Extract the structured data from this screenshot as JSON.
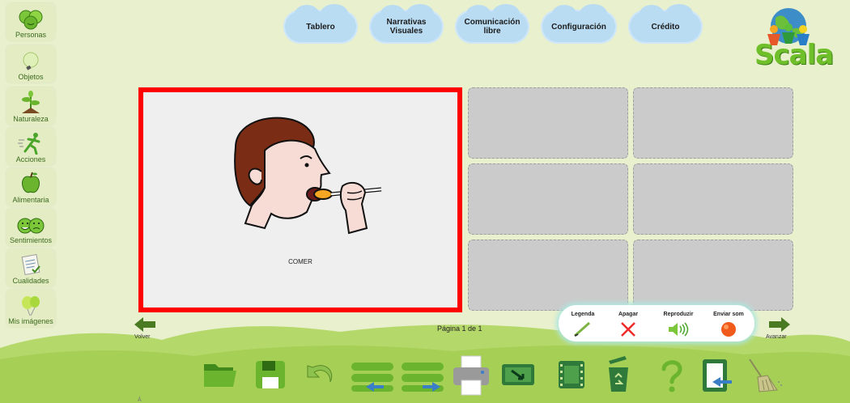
{
  "sidebar": {
    "items": [
      {
        "label": "Personas",
        "icon": "faces-icon"
      },
      {
        "label": "Objetos",
        "icon": "lightbulb-icon"
      },
      {
        "label": "Naturaleza",
        "icon": "sprout-icon"
      },
      {
        "label": "Acciones",
        "icon": "running-person-icon"
      },
      {
        "label": "Alimentaria",
        "icon": "apple-icon"
      },
      {
        "label": "Sentimientos",
        "icon": "emotion-faces-icon"
      },
      {
        "label": "Cualidades",
        "icon": "checklist-icon"
      },
      {
        "label": "Mis imágenes",
        "icon": "balloons-icon"
      }
    ]
  },
  "tabs": [
    {
      "label": "Tablero"
    },
    {
      "label": "Narrativas Visuales"
    },
    {
      "label": "Comunicación libre"
    },
    {
      "label": "Configuración"
    },
    {
      "label": "Crédito"
    }
  ],
  "logo": {
    "text": "Scala"
  },
  "board": {
    "main_caption": "COMER",
    "main_image_icon": "person-eating-icon",
    "selected_border_color": "#ff0000",
    "empty_cell_color": "#cbcbcb"
  },
  "nav": {
    "back_label": "Volver",
    "forward_label": "Avanzar",
    "page_indicator": "Página 1 de 1"
  },
  "legend_panel": {
    "items": [
      {
        "label": "Legenda",
        "icon": "pencil-icon"
      },
      {
        "label": "Apagar",
        "icon": "red-x-icon"
      },
      {
        "label": "Reproduzir",
        "icon": "speaker-icon"
      },
      {
        "label": "Enviar som",
        "icon": "record-dot-icon"
      }
    ]
  },
  "toolbar": {
    "tools": [
      {
        "name": "open-folder-icon"
      },
      {
        "name": "save-disk-icon"
      },
      {
        "name": "undo-icon"
      },
      {
        "name": "move-left-icon"
      },
      {
        "name": "move-right-icon"
      },
      {
        "name": "print-icon"
      },
      {
        "name": "screen-capture-icon"
      },
      {
        "name": "film-icon"
      },
      {
        "name": "trash-icon"
      },
      {
        "name": "help-icon"
      },
      {
        "name": "exit-icon"
      },
      {
        "name": "broom-icon"
      }
    ]
  },
  "colors": {
    "background": "#e9f0cd",
    "hill": "#b5d86b",
    "tab_cloud": "#b9dcf3",
    "accent_green": "#6fbf2a"
  },
  "bottom_fragment": "Á"
}
